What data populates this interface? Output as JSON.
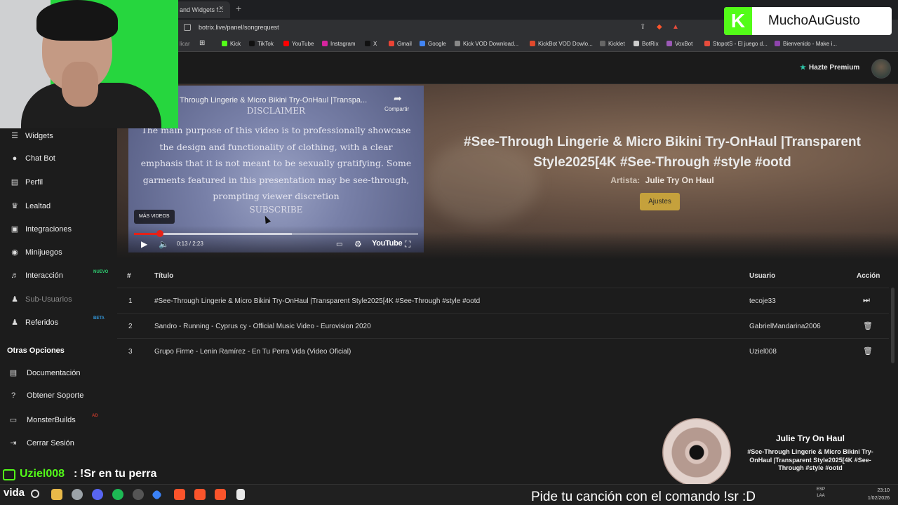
{
  "browser": {
    "tab_title": "and Widgets f...",
    "tab_close": "×",
    "new_tab": "+",
    "url": "botrix.live/panel/songrequest",
    "bookmarks": [
      {
        "label": "Kick",
        "color": "#53fc18"
      },
      {
        "label": "TikTok",
        "color": "#111111"
      },
      {
        "label": "YouTube",
        "color": "#ff0000"
      },
      {
        "label": "Instagram",
        "color": "#d6249f"
      },
      {
        "label": "X",
        "color": "#111111"
      },
      {
        "label": "Gmail",
        "color": "#ea4335"
      },
      {
        "label": "Google",
        "color": "#4285f4"
      },
      {
        "label": "Kick VOD Download...",
        "color": "#888888"
      },
      {
        "label": "KickBot VOD Dowlo...",
        "color": "#e0492c"
      },
      {
        "label": "Kicklet",
        "color": "#666666"
      },
      {
        "label": "BotRix",
        "color": "#cccccc"
      },
      {
        "label": "VoxBot",
        "color": "#9b59b6"
      },
      {
        "label": "StopotS - El juego d...",
        "color": "#e74c3c"
      },
      {
        "label": "Bienvenido - Make i...",
        "color": "#8e44ad"
      }
    ],
    "bookmark_partial": "licar"
  },
  "header": {
    "premium_label": "Hazte Premium"
  },
  "sidebar": {
    "items": [
      {
        "label": "Widgets",
        "icon": "☰",
        "name": "widgets"
      },
      {
        "label": "Chat Bot",
        "icon": "●",
        "name": "chat-bot"
      },
      {
        "label": "Perfil",
        "icon": "▤",
        "name": "perfil"
      },
      {
        "label": "Lealtad",
        "icon": "♛",
        "name": "lealtad"
      },
      {
        "label": "Integraciones",
        "icon": "▣",
        "name": "integraciones"
      },
      {
        "label": "Minijuegos",
        "icon": "◉",
        "name": "minijuegos"
      },
      {
        "label": "Interacción",
        "icon": "♬",
        "name": "interaccion",
        "badge": "NUEVO",
        "badge_color": "#2ecc71"
      },
      {
        "label": "Sub-Usuarios",
        "icon": "♟",
        "name": "sub-usuarios",
        "dim": true
      },
      {
        "label": "Referidos",
        "icon": "♟",
        "name": "referidos",
        "badge": "BETA",
        "badge_color": "#3498db"
      }
    ],
    "section_title": "Otras Opciones",
    "other_items": [
      {
        "label": "Documentación",
        "icon": "▤",
        "name": "documentacion"
      },
      {
        "label": "Obtener Soporte",
        "icon": "?",
        "name": "obtener-soporte"
      },
      {
        "label": "MonsterBuilds",
        "icon": "▭",
        "name": "monsterbuilds",
        "badge": "AD",
        "badge_color": "#c0392b"
      },
      {
        "label": "Cerrar Sesión",
        "icon": "⇥",
        "name": "cerrar-sesion"
      }
    ]
  },
  "player": {
    "video_title": "Through Lingerie & Micro Bikini Try-OnHaul |Transpa...",
    "share_label": "Compartir",
    "disclaimer_title": "DISCLAIMER",
    "disclaimer_body": "The main purpose of this video is to professionally showcase the design and functionality of clothing, with a clear emphasis that it is not meant to be sexually gratifying. Some garments featured in this presentation may be see-through, prompting viewer discretion",
    "subscribe": "SUBSCRIBE",
    "more_videos": "MÁS VIDEOS",
    "time": "0:13 / 2:23",
    "progress": 0.092,
    "youtube_label": "YouTube"
  },
  "now_playing": {
    "title": "#See-Through Lingerie & Micro Bikini Try-OnHaul |Transparent Style2025[4K #See-Through #style #ootd",
    "artist_label": "Artista:",
    "artist": "Julie Try On Haul",
    "settings_button": "Ajustes"
  },
  "queue": {
    "headers": {
      "num": "#",
      "title": "Título",
      "user": "Usuario",
      "action": "Acción"
    },
    "rows": [
      {
        "num": "1",
        "title": "#See-Through Lingerie & Micro Bikini Try-OnHaul |Transparent Style2025[4K #See-Through #style #ootd",
        "user": "tecoje33",
        "action_icon": "skip-icon",
        "action_glyph": "⏭"
      },
      {
        "num": "2",
        "title": "Sandro - Running - Cyprus cy - Official Music Video - Eurovision 2020",
        "user": "GabrielMandarina2006",
        "action_icon": "trash-icon",
        "action_glyph": "🗑"
      },
      {
        "num": "3",
        "title": "Grupo Firme - Lenin Ramírez - En Tu Perra Vida (Video Oficial)",
        "user": "Uziel008",
        "action_icon": "trash-icon",
        "action_glyph": "🗑"
      }
    ]
  },
  "overlay": {
    "brand_letter": "K",
    "brand_name": "MuchoAuGusto",
    "brand_color": "#53fc18",
    "widget_artist": "Julie Try On Haul",
    "widget_title": "#See-Through Lingerie & Micro Bikini Try-OnHaul |Transparent Style2025[4K #See-Through #style #ootd",
    "chat_user": "Uziel008",
    "chat_sep": ":",
    "chat_message": "!Sr en tu perra",
    "ticker": "Pide tu canción con el comando !sr :D"
  },
  "taskbar": {
    "start_text": "vida",
    "lang_line1": "ESP",
    "lang_line2": "LAA",
    "time": "23:10",
    "date": "1/02/2026"
  }
}
